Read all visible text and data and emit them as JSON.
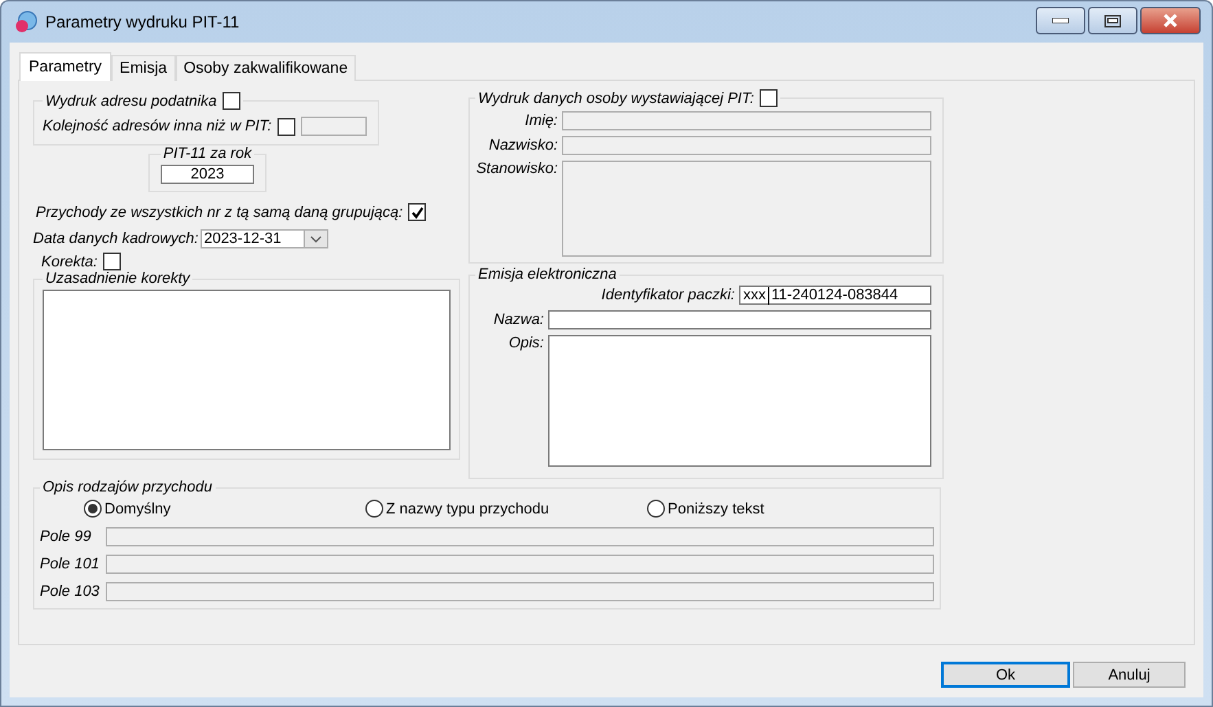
{
  "window": {
    "title": "Parametry wydruku PIT-11"
  },
  "tabs": [
    {
      "label": "Parametry",
      "selected": true
    },
    {
      "label": "Emisja",
      "selected": false
    },
    {
      "label": "Osoby zakwalifikowane",
      "selected": false
    }
  ],
  "address_group": {
    "title": "Wydruk adresu podatnika",
    "checked": false,
    "order_label": "Kolejność adresów inna niż w PIT:",
    "order_checked": false,
    "order_field_disabled": true
  },
  "year_group": {
    "title": "PIT-11 za rok",
    "value": "2023"
  },
  "income_grouping": {
    "label": "Przychody ze wszystkich nr z tą samą daną grupującą:",
    "checked": true
  },
  "hr_date": {
    "label": "Data danych kadrowych:",
    "value": "2023-12-31"
  },
  "correction": {
    "label": "Korekta:",
    "checked": false
  },
  "correction_reason": {
    "title": "Uzasadnienie korekty"
  },
  "issuer_group": {
    "title": "Wydruk danych osoby wystawiającej PIT:",
    "checked": false,
    "fields": [
      {
        "label": "Imię:",
        "kind": "line",
        "disabled": true
      },
      {
        "label": "Nazwisko:",
        "kind": "line",
        "disabled": true
      },
      {
        "label": "Stanowisko:",
        "kind": "area",
        "disabled": true
      }
    ]
  },
  "emission_group": {
    "title": "Emisja elektroniczna",
    "package_id": {
      "label": "Identyfikator paczki:",
      "prefix": "xxx",
      "value": "11-240124-083844"
    },
    "fields": [
      {
        "label": "Nazwa:",
        "kind": "line",
        "disabled": false
      },
      {
        "label": "Opis:",
        "kind": "area",
        "disabled": false
      }
    ]
  },
  "income_desc": {
    "title": "Opis rodzajów przychodu",
    "options": [
      {
        "label": "Domyślny",
        "selected": true
      },
      {
        "label": "Z nazwy typu przychodu",
        "selected": false
      },
      {
        "label": "Poniższy tekst",
        "selected": false
      }
    ],
    "fields": [
      {
        "label": "Pole 99",
        "disabled": true
      },
      {
        "label": "Pole 101",
        "disabled": true
      },
      {
        "label": "Pole 103",
        "disabled": true
      }
    ]
  },
  "buttons": [
    {
      "label": "Ok",
      "default": true
    },
    {
      "label": "Anuluj",
      "default": false
    }
  ]
}
